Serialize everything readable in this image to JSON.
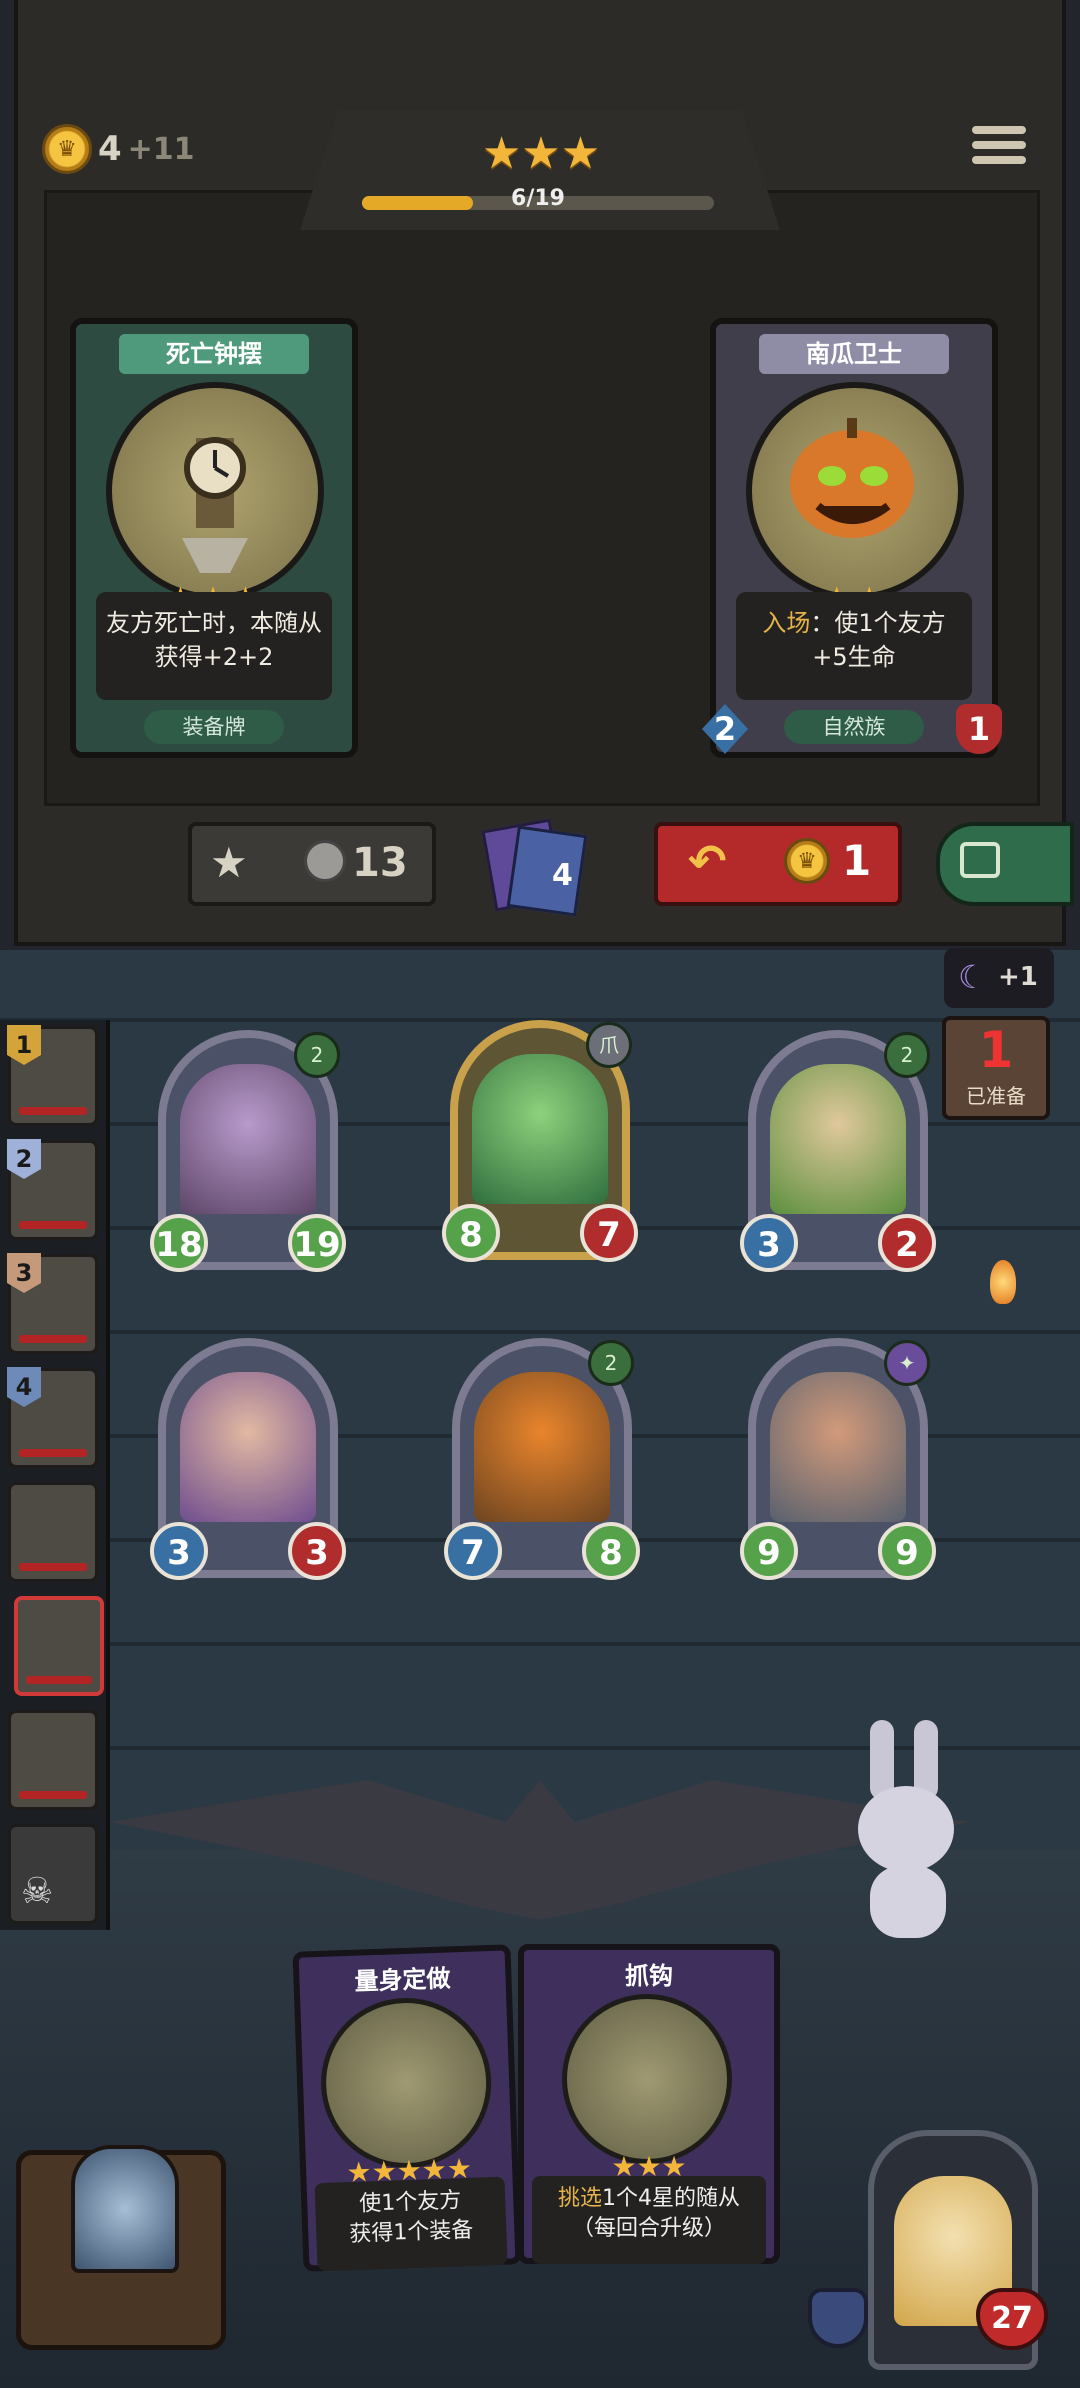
{
  "top_bar": {
    "gold": "4",
    "gold_income": "+11",
    "tier_stars": 3,
    "progress_text": "6/19",
    "progress_fraction": 0.316
  },
  "shop_cards": [
    {
      "title": "死亡钟摆",
      "stars": 3,
      "desc_line1": "友方死亡时，本随从",
      "desc_line2": "获得+2+2",
      "tag": "装备牌",
      "frame": "#4f9a7c"
    },
    {
      "title": "南瓜卫士",
      "stars": 2,
      "desc_line1": "入场：使1个友方",
      "desc_line2": "+5生命",
      "desc_keyword": "入场",
      "tag": "自然族",
      "attack": "2",
      "health": "1",
      "frame": "#9a98b0"
    }
  ],
  "actions": {
    "upgrade_cost": "13",
    "spell_count": "4",
    "refresh_cost": "1"
  },
  "ready": {
    "bonus": "+1",
    "count": "1",
    "label": "已准备"
  },
  "players": [
    {
      "rank": "1"
    },
    {
      "rank": "2"
    },
    {
      "rank": "3"
    },
    {
      "rank": "4"
    },
    {
      "rank": ""
    },
    {
      "rank": ""
    },
    {
      "rank": ""
    },
    {
      "rank": ""
    }
  ],
  "minions": [
    {
      "name": "mushroom",
      "attack": "18",
      "health": "19",
      "tribe": "2"
    },
    {
      "name": "crocodile",
      "attack": "8",
      "health": "7",
      "tribe": "爪"
    },
    {
      "name": "leaf-girl",
      "attack": "3",
      "health": "2",
      "tribe": "2"
    },
    {
      "name": "witch",
      "attack": "3",
      "health": "3",
      "tribe": ""
    },
    {
      "name": "pumpkin",
      "attack": "7",
      "health": "8",
      "tribe": "2"
    },
    {
      "name": "dwarf",
      "attack": "9",
      "health": "9",
      "tribe": "✦"
    }
  ],
  "hand": [
    {
      "title": "量身定做",
      "stars": 5,
      "desc_line1": "使1个友方",
      "desc_line2": "获得1个装备"
    },
    {
      "title": "抓钩",
      "stars": 3,
      "desc_line1": "挑选1个4星的随从",
      "desc_line2": "（每回合升级）",
      "desc_keyword": "挑选"
    }
  ],
  "hero": {
    "health": "27"
  }
}
